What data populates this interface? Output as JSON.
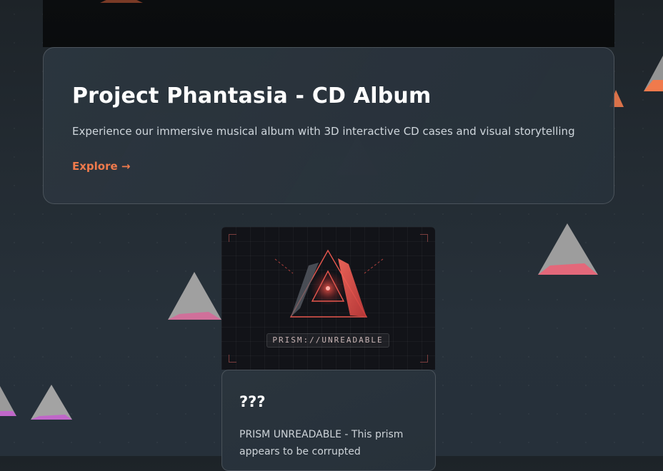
{
  "feature_card": {
    "title": "Project Phantasia - CD Album",
    "description": "Experience our immersive musical album with 3D interactive CD cases and visual storytelling",
    "link_label": "Explore →"
  },
  "prism_card": {
    "tag": "PRISM://UNREADABLE",
    "title": "???",
    "description": "PRISM UNREADABLE - This prism appears to be corrupted"
  },
  "colors": {
    "accent": "#f07a4c",
    "prism_red": "#e8574e",
    "background": "#232b32"
  }
}
